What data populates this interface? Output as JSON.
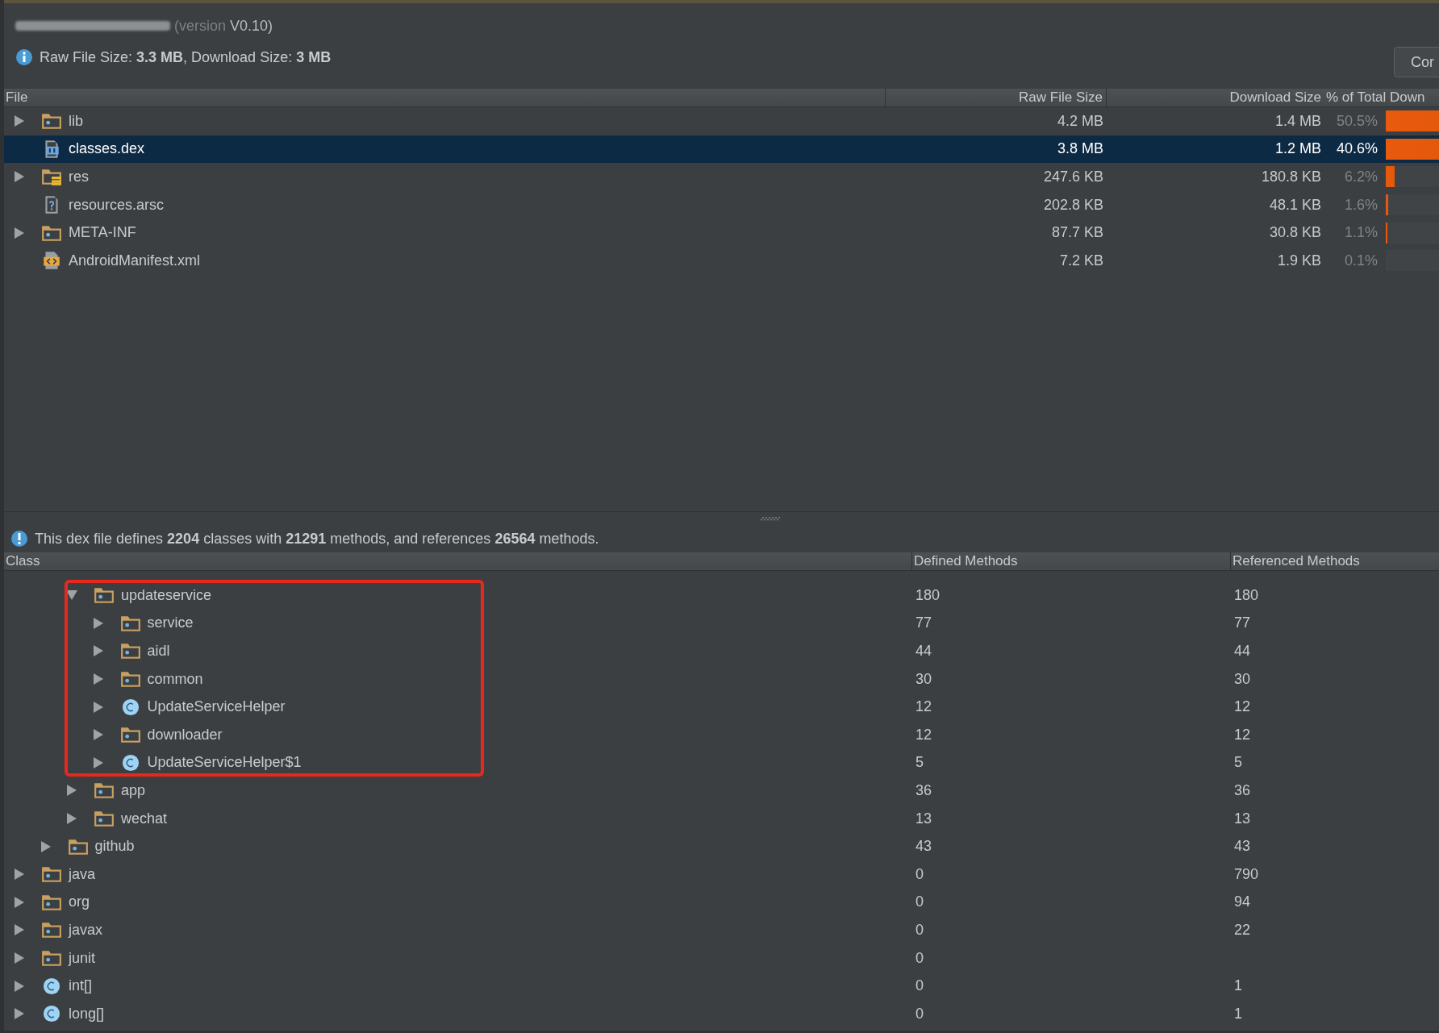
{
  "header": {
    "version_label": "(version",
    "version": "V0.10)",
    "info": "Raw File Size: **3.3 MB**, Download Size: **3 MB**",
    "button": "Cor"
  },
  "files": {
    "columns": [
      "File",
      "Raw File Size",
      "Download Size",
      "% of Total Down"
    ],
    "rows": [
      {
        "name": "lib",
        "kind": "folder",
        "expanded": false,
        "selected": false,
        "raw": "4.2 MB",
        "download": "1.4 MB",
        "percent": "50.5%",
        "level": 0.505
      },
      {
        "name": "classes.dex",
        "kind": "dex",
        "selected": true,
        "raw": "3.8 MB",
        "download": "1.2 MB",
        "percent": "40.6%",
        "level": 0.406
      },
      {
        "name": "res",
        "kind": "res",
        "expanded": false,
        "selected": false,
        "raw": "247.6 KB",
        "download": "180.8 KB",
        "percent": "6.2%",
        "level": 0.062
      },
      {
        "name": "resources.arsc",
        "kind": "arsc",
        "selected": false,
        "raw": "202.8 KB",
        "download": "48.1 KB",
        "percent": "1.6%",
        "level": 0.016
      },
      {
        "name": "META-INF",
        "kind": "folder",
        "expanded": false,
        "selected": false,
        "raw": "87.7 KB",
        "download": "30.8 KB",
        "percent": "1.1%",
        "level": 0.011
      },
      {
        "name": "AndroidManifest.xml",
        "kind": "xml",
        "selected": false,
        "raw": "7.2 KB",
        "download": "1.9 KB",
        "percent": "0.1%",
        "level": 0.001
      }
    ]
  },
  "dex_info": "This dex file defines **2204** classes with **21291** methods, and references **26564** methods.",
  "classes": {
    "columns": [
      "Class",
      "Defined Methods",
      "Referenced Methods"
    ],
    "rows": [
      {
        "children": [
          {
            "children": [
              {
                "name": "updateservice",
                "kind": "package",
                "expanded": true,
                "highlighted": true,
                "defined": "180",
                "referenced": "180",
                "children": [
                  {
                    "name": "service",
                    "kind": "package",
                    "expanded": false,
                    "defined": "77",
                    "referenced": "77"
                  },
                  {
                    "name": "aidl",
                    "kind": "package",
                    "expanded": false,
                    "defined": "44",
                    "referenced": "44"
                  },
                  {
                    "name": "common",
                    "kind": "package",
                    "expanded": false,
                    "defined": "30",
                    "referenced": "30"
                  },
                  {
                    "name": "UpdateServiceHelper",
                    "kind": "class",
                    "expanded": false,
                    "defined": "12",
                    "referenced": "12"
                  },
                  {
                    "name": "downloader",
                    "kind": "package",
                    "expanded": false,
                    "defined": "12",
                    "referenced": "12"
                  },
                  {
                    "name": "UpdateServiceHelper$1",
                    "kind": "class",
                    "expanded": false,
                    "defined": "5",
                    "referenced": "5"
                  }
                ]
              },
              {
                "name": "app",
                "kind": "package",
                "expanded": false,
                "defined": "36",
                "referenced": "36"
              },
              {
                "name": "wechat",
                "kind": "package",
                "expanded": false,
                "defined": "13",
                "referenced": "13"
              }
            ]
          },
          {
            "name": "github",
            "kind": "package",
            "expanded": false,
            "defined": "43",
            "referenced": "43"
          }
        ]
      },
      {
        "name": "java",
        "kind": "package",
        "expanded": false,
        "defined": "0",
        "referenced": "790"
      },
      {
        "name": "org",
        "kind": "package",
        "expanded": false,
        "defined": "0",
        "referenced": "94"
      },
      {
        "name": "javax",
        "kind": "package",
        "expanded": false,
        "defined": "0",
        "referenced": "22"
      },
      {
        "name": "junit",
        "kind": "package",
        "expanded": false,
        "defined": "0"
      },
      {
        "name": "int[]",
        "kind": "class",
        "expanded": false,
        "defined": "0",
        "referenced": "1"
      },
      {
        "name": "long[]",
        "kind": "class",
        "expanded": false,
        "defined": "0",
        "referenced": "1"
      }
    ]
  }
}
